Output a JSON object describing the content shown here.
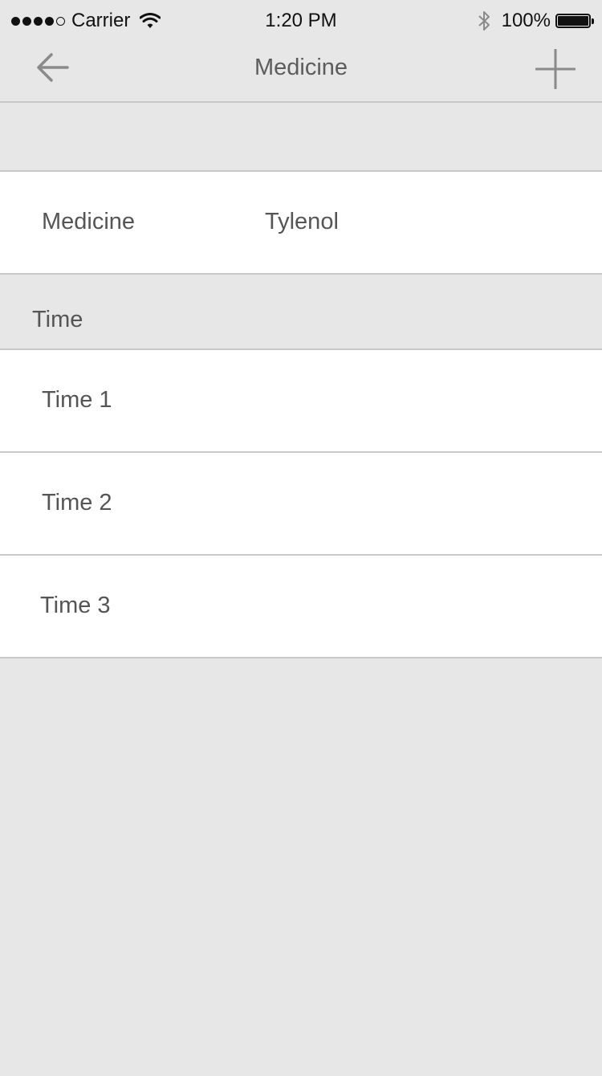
{
  "status_bar": {
    "carrier": "Carrier",
    "time": "1:20 PM",
    "battery": "100%",
    "icons": [
      "signal-icon",
      "wifi-icon",
      "bluetooth-icon",
      "battery-icon"
    ]
  },
  "nav": {
    "title": "Medicine",
    "back_icon": "arrow-left-icon",
    "add_icon": "plus-icon"
  },
  "medicine": {
    "label": "Medicine",
    "value": "Tylenol"
  },
  "time_section": {
    "header": "Time",
    "rows": [
      {
        "label": "Time 1"
      },
      {
        "label": "Time 2"
      },
      {
        "label": "Time 3"
      }
    ]
  },
  "colors": {
    "background": "#e7e7e7",
    "row_background": "#ffffff",
    "separator": "#c9c9c9",
    "text": "#555555",
    "icon": "#8a8a8a"
  }
}
